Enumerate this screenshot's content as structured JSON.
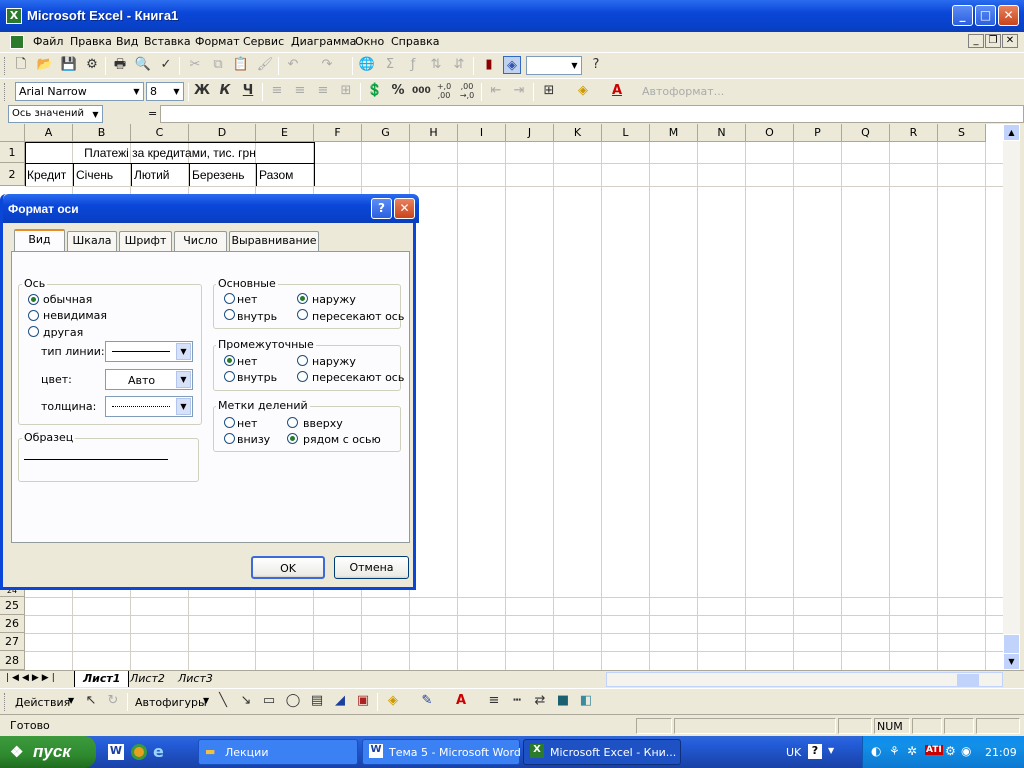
{
  "window": {
    "title": "Microsoft Excel - Книга1",
    "app_icon": "excel-icon"
  },
  "menu": [
    "Файл",
    "Правка",
    "Вид",
    "Вставка",
    "Формат",
    "Сервис",
    "Диаграмма",
    "Окно",
    "Справка"
  ],
  "formatting": {
    "font": "Arial Narrow",
    "size": "8",
    "bold": "Ж",
    "italic": "К",
    "underline": "Ч",
    "percent": "%",
    "thousands": "000",
    "inc_decimal": ",0\n,00",
    "autoformat": "Автоформат..."
  },
  "formula_bar": {
    "name_box": "Ось значений",
    "fx": "="
  },
  "grid": {
    "columns": [
      "A",
      "B",
      "C",
      "D",
      "E",
      "F",
      "G",
      "H",
      "I",
      "J",
      "K",
      "L",
      "M",
      "N",
      "O",
      "P",
      "Q",
      "R",
      "S"
    ],
    "rows_top": [
      "1",
      "2"
    ],
    "rows_bottom": [
      "25",
      "26",
      "27",
      "28"
    ],
    "row_partial": "24",
    "title_cell": "Платежі за кредитами, тис. грн",
    "header_row": [
      "Кредит",
      "Січень",
      "Лютий",
      "Березень",
      "Разом"
    ]
  },
  "sheets": [
    "Лист1",
    "Лист2",
    "Лист3"
  ],
  "drawing": {
    "actions": "Действия",
    "autoshapes": "Автофигуры"
  },
  "status": {
    "ready": "Готово",
    "num": "NUM"
  },
  "taskbar": {
    "start": "пуск",
    "tasks": [
      "Лекции",
      "Тема 5 - Microsoft Word",
      "Microsoft Excel - Кни..."
    ],
    "lang": "UK",
    "clock": "21:09"
  },
  "dialog": {
    "title": "Формат оси",
    "tabs": [
      "Вид",
      "Шкала",
      "Шрифт",
      "Число",
      "Выравнивание"
    ],
    "axis_group": "Ось",
    "axis_options": [
      "обычная",
      "невидимая",
      "другая"
    ],
    "axis_selected": "обычная",
    "line_type_label": "тип линии:",
    "color_label": "цвет:",
    "color_value": "Авто",
    "thickness_label": "толщина:",
    "sample_label": "Образец",
    "major_group": "Основные",
    "major_options": [
      "нет",
      "наружу",
      "внутрь",
      "пересекают ось"
    ],
    "major_selected": "наружу",
    "minor_group": "Промежуточные",
    "minor_options": [
      "нет",
      "наружу",
      "внутрь",
      "пересекают ось"
    ],
    "minor_selected": "нет",
    "ticklabels_group": "Метки делений",
    "ticklabel_options": [
      "нет",
      "вверху",
      "внизу",
      "рядом с осью"
    ],
    "ticklabel_selected": "рядом с осью",
    "ok": "OK",
    "cancel": "Отмена"
  }
}
